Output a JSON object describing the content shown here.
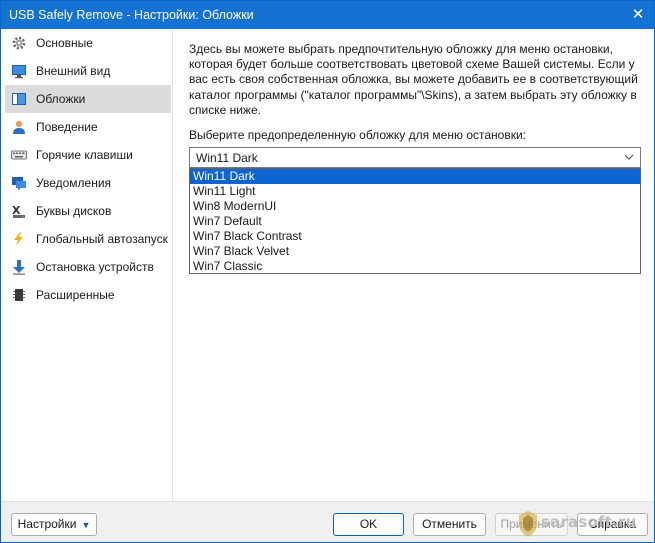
{
  "window": {
    "title": "USB Safely Remove - Настройки: Обложки",
    "close_glyph": "✕"
  },
  "sidebar": {
    "items": [
      {
        "label": "Основные",
        "icon": "gear-icon"
      },
      {
        "label": "Внешний вид",
        "icon": "monitor-icon"
      },
      {
        "label": "Обложки",
        "icon": "skin-icon",
        "active": true
      },
      {
        "label": "Поведение",
        "icon": "user-icon"
      },
      {
        "label": "Горячие клавиши",
        "icon": "keyboard-icon"
      },
      {
        "label": "Уведомления",
        "icon": "notification-icon"
      },
      {
        "label": "Буквы дисков",
        "icon": "drive-letter-icon"
      },
      {
        "label": "Глобальный автозапуск",
        "icon": "lightning-icon"
      },
      {
        "label": "Остановка устройств",
        "icon": "download-arrow-icon"
      },
      {
        "label": "Расширенные",
        "icon": "chip-icon"
      }
    ]
  },
  "main": {
    "description_lines": [
      "Здесь вы можете выбрать предпочтительную обложку для меню остановки,",
      "которая будет больше соответствовать цветовой схеме Вашей системы. Если у",
      "вас есть своя собственная обложка, вы можете добавить ее в соответствующий",
      "каталог программы (\"каталог программы\"\\Skins), а затем выбрать эту обложку в",
      "списке ниже."
    ],
    "combo_label": "Выберите предопределенную обложку для меню остановки:",
    "combo_value": "Win11 Dark",
    "options": [
      "Win11 Dark",
      "Win11 Light",
      "Win8 ModernUI",
      "Win7 Default",
      "Win7 Black Contrast",
      "Win7 Black Velvet",
      "Win7 Classic"
    ],
    "selected_index": 0
  },
  "footer": {
    "settings_label": "Настройки",
    "ok_label": "OK",
    "cancel_label": "Отменить",
    "apply_label": "Применить",
    "help_label": "Справка"
  },
  "watermark": {
    "text": "sarasoft.ru"
  },
  "colors": {
    "titlebar": "#1473d2",
    "selection": "#0a64d2",
    "active_nav": "#dcdcdc"
  }
}
